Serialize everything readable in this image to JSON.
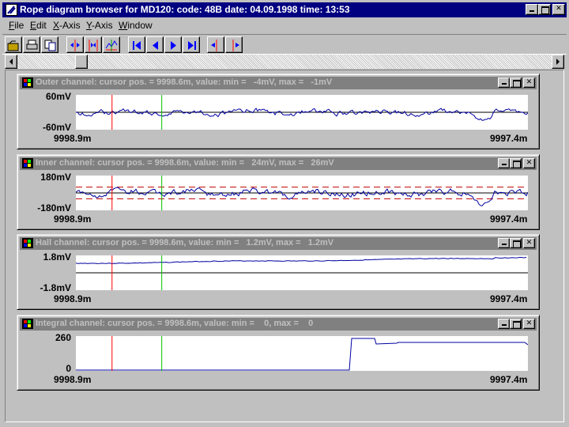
{
  "window": {
    "title": "Rope diagram browser for MD120: code: 48B date: 04.09.1998 time: 13:53",
    "colors": {
      "titlebar_active": "#000080",
      "titlebar_inactive": "#808080",
      "face": "#c0c0c0"
    }
  },
  "menu": [
    {
      "label": "File",
      "accel": "F"
    },
    {
      "label": "Edit",
      "accel": "E"
    },
    {
      "label": "X-Axis",
      "accel": "X"
    },
    {
      "label": "Y-Axis",
      "accel": "Y"
    },
    {
      "label": "Window",
      "accel": "W"
    }
  ],
  "toolbar": {
    "buttons": [
      "open-icon",
      "print-icon",
      "copy-icon",
      "zoom-in-x-icon",
      "zoom-out-x-icon",
      "auto-scale-icon",
      "first-icon",
      "previous-icon",
      "next-icon",
      "last-icon",
      "cursor-left-icon",
      "cursor-right-icon"
    ]
  },
  "scrollbar": {
    "left_icon": "arrow-left-icon",
    "right_icon": "arrow-right-icon",
    "position": 0.11
  },
  "channels": [
    {
      "title": "Outer channel: cursor pos. = 9998.6m, value: min =   -4mV, max =   -1mV",
      "ymax": "60mV",
      "ymin": "-60mV",
      "xstart": "9998.9m",
      "xend": "9997.4m",
      "range": [
        -60,
        60
      ],
      "baseline": 0,
      "thresholds": [],
      "signal": "noise",
      "amp": 0.18,
      "seed": 1
    },
    {
      "title": "Inner channel: cursor pos. = 9998.6m, value: min =   24mV, max =   26mV",
      "ymax": "180mV",
      "ymin": "-180mV",
      "xstart": "9998.9m",
      "xend": "9997.4m",
      "range": [
        -180,
        180
      ],
      "baseline": 0,
      "thresholds": [
        60,
        -60
      ],
      "signal": "noise",
      "amp": 0.22,
      "seed": 2
    },
    {
      "title": "Hall channel: cursor pos. = 9998.6m, value: min =   1.2mV, max =   1.2mV",
      "ymax": "1.8mV",
      "ymin": "-1.8mV",
      "xstart": "9998.9m",
      "xend": "9997.4m",
      "range": [
        -1.8,
        1.8
      ],
      "baseline": 0,
      "thresholds": [],
      "signal": "hall",
      "amp": 0.0,
      "seed": 3
    },
    {
      "title": "Integral channel: cursor pos. = 9998.6m, value: min =    0, max =    0",
      "ymax": "260",
      "ymin": "0",
      "xstart": "9998.9m",
      "xend": "9997.4m",
      "range": [
        0,
        260
      ],
      "baseline": null,
      "thresholds": [],
      "signal": "integral",
      "amp": 0.0,
      "seed": 4
    }
  ],
  "cursors": {
    "red": 0.08,
    "green": 0.19,
    "red_color": "#ff0000",
    "green_color": "#00c000"
  }
}
